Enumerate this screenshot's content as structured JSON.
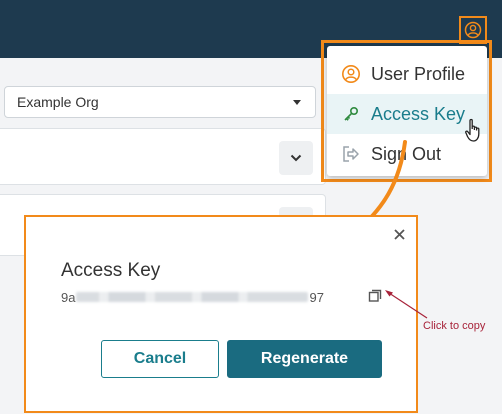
{
  "org_selector": {
    "value": "Example Org"
  },
  "user_menu": {
    "items": [
      {
        "label": "User Profile",
        "icon": "user-circle-icon"
      },
      {
        "label": "Access Key",
        "icon": "key-icon",
        "hovered": true
      },
      {
        "label": "Sign Out",
        "icon": "sign-out-icon"
      }
    ]
  },
  "dialog": {
    "title": "Access Key",
    "key_prefix": "9a",
    "key_suffix": "97",
    "cancel_label": "Cancel",
    "regenerate_label": "Regenerate"
  },
  "annotation": {
    "copy_hint": "Click to copy"
  },
  "colors": {
    "topbar": "#1e3a4f",
    "highlight": "#f28a1a",
    "accent": "#1a7d8c",
    "primary_button": "#1a6b80",
    "annotation": "#a8233a"
  }
}
